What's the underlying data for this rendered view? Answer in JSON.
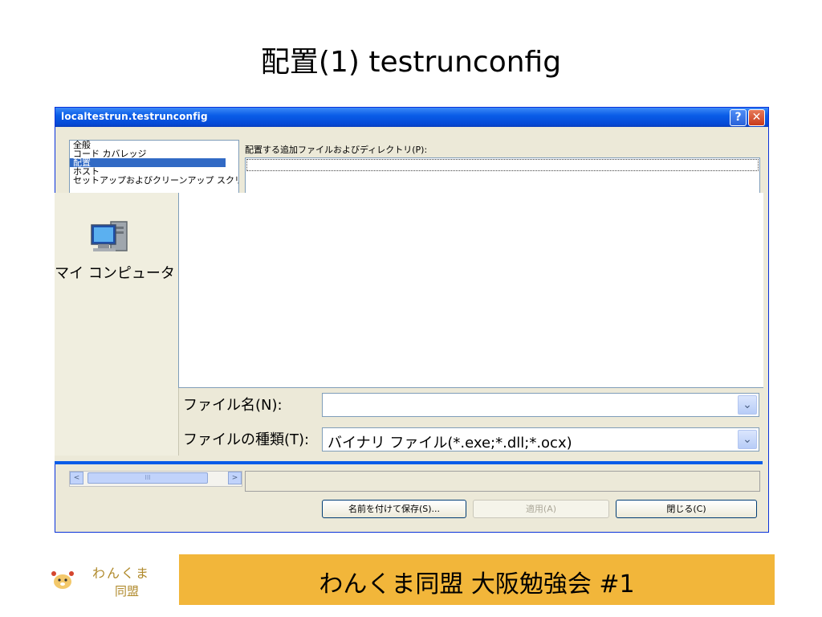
{
  "slide": {
    "title": "配置(1) testrunconfig"
  },
  "dialog": {
    "title": "localtestrun.testrunconfig",
    "help_glyph": "?",
    "close_glyph": "✕",
    "tree_items": [
      "全般",
      "コード カバレッジ",
      "配置",
      "ホスト",
      "セットアップおよびクリーンアップ スクリプト"
    ],
    "selected_item": "配置",
    "files_label": "配置する追加ファイルおよびディレクトリ(P):",
    "scroll_left": "<",
    "scroll_right": ">",
    "scroll_grip": "III",
    "buttons": {
      "save_as": "名前を付けて保存(S)...",
      "apply": "適用(A)",
      "close": "閉じる(C)"
    }
  },
  "save_dialog": {
    "place_label": "マイ コンピュータ",
    "filename_label": "ファイル名(N):",
    "filename_value": "",
    "filetype_label": "ファイルの種類(T):",
    "filetype_value": "バイナリ ファイル(*.exe;*.dll;*.ocx)",
    "dropdown_glyph": "⌄"
  },
  "footer": {
    "logo_line1": "わんくま",
    "logo_line2": "同盟",
    "text": "わんくま同盟 大阪勉強会 #1"
  },
  "colors": {
    "titlebar": "#0a5de8",
    "selection": "#316ac5",
    "footer_bar": "#f2b63a",
    "dialog_face": "#ece9d8"
  }
}
